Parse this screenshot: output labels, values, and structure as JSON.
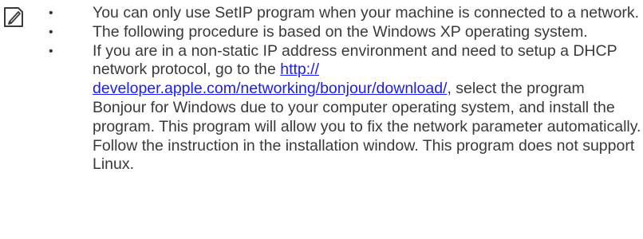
{
  "note": {
    "icon": "note-pencil-icon",
    "bullet_glyph": "•",
    "items": [
      {
        "text": "You can only use SetIP program when your machine is connected to a network."
      },
      {
        "text": "The following procedure is based on the Windows XP operating system."
      },
      {
        "text_before": "If you are in a non-static IP address environment and need to setup a DHCP network protocol, go to the ",
        "link": "http:// developer.apple.com/networking/bonjour/download/",
        "text_after": ", select the program Bonjour for Windows due to your computer operating system, and install the program. This program will allow you to fix the network parameter automatically. Follow the instruction in the installation window. This program does not support Linux."
      }
    ]
  }
}
